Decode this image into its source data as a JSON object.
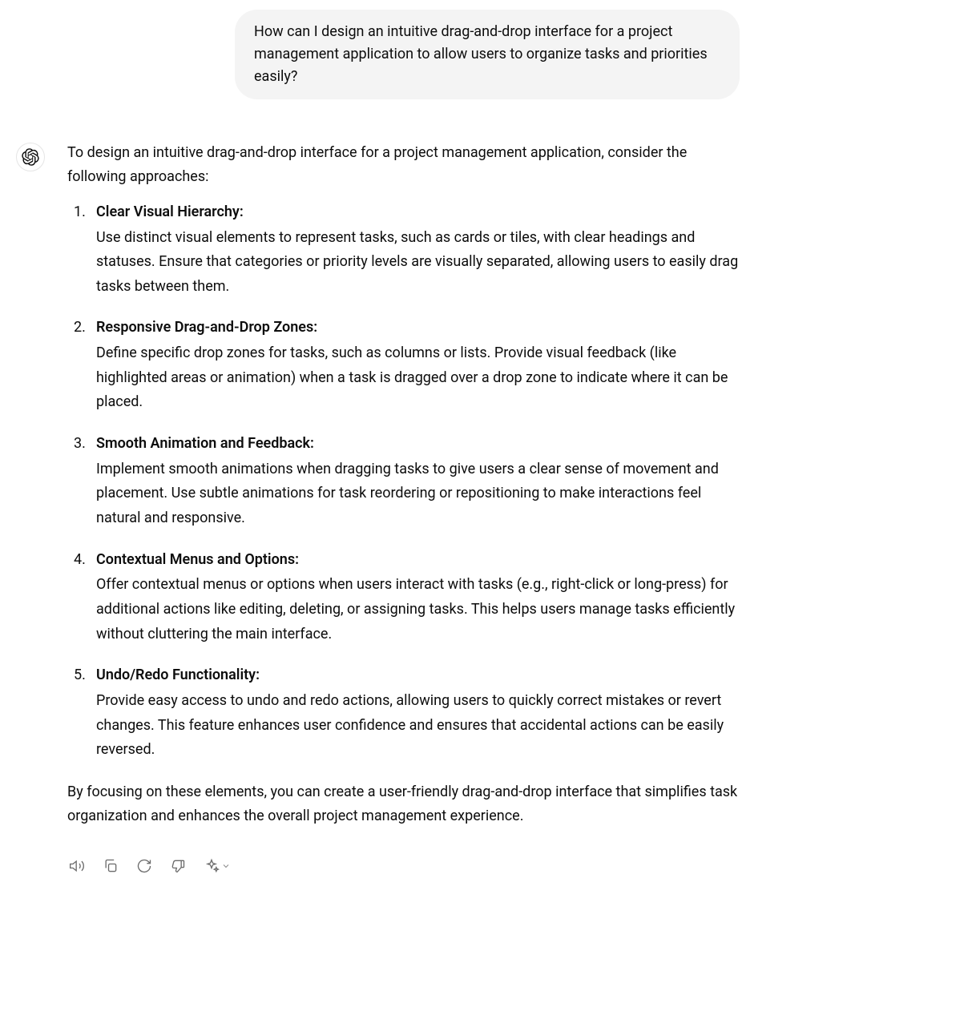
{
  "user_message": "How can I design an intuitive drag-and-drop interface for a project management application to allow users to organize tasks and priorities easily?",
  "assistant": {
    "intro": "To design an intuitive drag-and-drop interface for a project management application, consider the following approaches:",
    "points": [
      {
        "title": "Clear Visual Hierarchy:",
        "body": "Use distinct visual elements to represent tasks, such as cards or tiles, with clear headings and statuses. Ensure that categories or priority levels are visually separated, allowing users to easily drag tasks between them."
      },
      {
        "title": "Responsive Drag-and-Drop Zones:",
        "body": "Define specific drop zones for tasks, such as columns or lists. Provide visual feedback (like highlighted areas or animation) when a task is dragged over a drop zone to indicate where it can be placed."
      },
      {
        "title": "Smooth Animation and Feedback:",
        "body": "Implement smooth animations when dragging tasks to give users a clear sense of movement and placement. Use subtle animations for task reordering or repositioning to make interactions feel natural and responsive."
      },
      {
        "title": "Contextual Menus and Options:",
        "body": "Offer contextual menus or options when users interact with tasks (e.g., right-click or long-press) for additional actions like editing, deleting, or assigning tasks. This helps users manage tasks efficiently without cluttering the main interface."
      },
      {
        "title": "Undo/Redo Functionality:",
        "body": "Provide easy access to undo and redo actions, allowing users to quickly correct mistakes or revert changes. This feature enhances user confidence and ensures that accidental actions can be easily reversed."
      }
    ],
    "outro": "By focusing on these elements, you can create a user-friendly drag-and-drop interface that simplifies task organization and enhances the overall project management experience."
  },
  "actions": {
    "read_aloud": "Read aloud",
    "copy": "Copy",
    "regenerate": "Regenerate",
    "bad_response": "Bad response",
    "change_model": "Change model"
  }
}
